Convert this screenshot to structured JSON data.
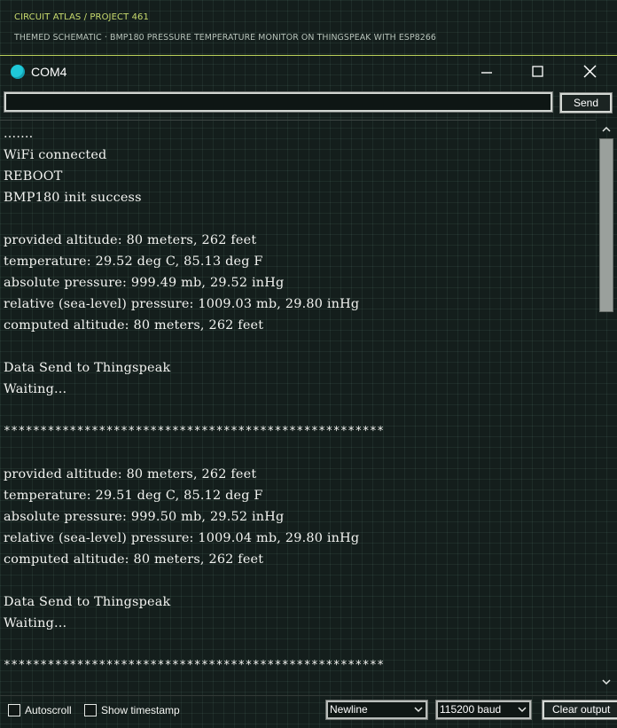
{
  "header": {
    "breadcrumb": "CIRCUIT ATLAS / PROJECT 461",
    "subtitle": "THEMED SCHEMATIC · BMP180 PRESSURE TEMPERATURE MONITOR ON THINGSPEAK WITH ESP8266"
  },
  "window": {
    "title": "COM4",
    "icon": "serial-monitor-icon",
    "accent": "#1fc8d8"
  },
  "input_row": {
    "value": "",
    "send_label": "Send"
  },
  "console": {
    "lines": [
      ".......",
      "WiFi connected",
      "REBOOT",
      "BMP180 init success",
      "",
      "provided altitude: 80 meters, 262 feet",
      "temperature: 29.52 deg C, 85.13 deg F",
      "absolute pressure: 999.49 mb, 29.52 inHg",
      "relative (sea-level) pressure: 1009.03 mb, 29.80 inHg",
      "computed altitude: 80 meters, 262 feet",
      "",
      "Data Send to Thingspeak",
      "Waiting...",
      "",
      "****************************************************",
      "",
      "provided altitude: 80 meters, 262 feet",
      "temperature: 29.51 deg C, 85.12 deg F",
      "absolute pressure: 999.50 mb, 29.52 inHg",
      "relative (sea-level) pressure: 1009.04 mb, 29.80 inHg",
      "computed altitude: 80 meters, 262 feet",
      "",
      "Data Send to Thingspeak",
      "Waiting...",
      "",
      "****************************************************"
    ]
  },
  "footer": {
    "autoscroll_label": "Autoscroll",
    "timestamp_label": "Show timestamp",
    "line_ending": "Newline",
    "baud_rate": "115200 baud",
    "clear_label": "Clear output"
  },
  "colors": {
    "background": "#141e1c",
    "header_accent": "#c9dc6e",
    "text": "#f3f4f1"
  }
}
